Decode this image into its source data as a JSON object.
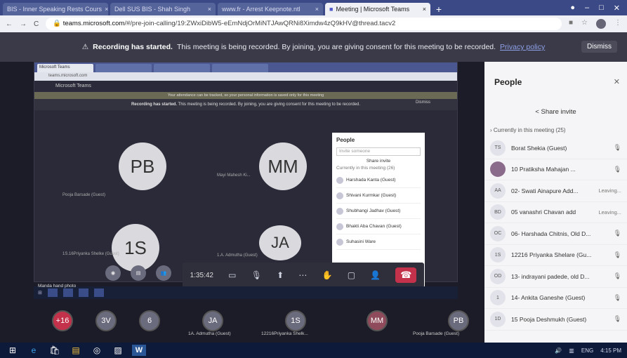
{
  "browser": {
    "tabs": [
      {
        "label": "BIS - Inner Speaking Rests Cours"
      },
      {
        "label": "Dell SUS BIS - Shah Singh"
      },
      {
        "label": "www.fr - Arrest Keepnote.ntl"
      },
      {
        "label": "Meeting | Microsoft Teams",
        "active": true
      }
    ],
    "url_host": "teams.microsoft.com",
    "url_path": "/#/pre-join-calling/19:ZWxiDibW5-eEmNdjOrMiNTJAwQRNi8Ximdw4zQ9kHV@thread.tacv2"
  },
  "banner": {
    "warning_icon": "warning-icon",
    "title": "Recording has started.",
    "text": "This meeting is being recorded. By joining, you are giving consent for this meeting to be recorded.",
    "policy_link": "Privacy policy",
    "dismiss": "Dismiss"
  },
  "shared_screen": {
    "app_title": "Microsoft Teams",
    "notice": "Your attendance can be tracked, so your personal information is saved only for this meeting",
    "rec_title": "Recording has started.",
    "rec_text": "This meeting is being recorded. By joining, you are giving consent for this meeting to be recorded.",
    "dismiss": "Dismiss",
    "tiles": [
      {
        "initials": "PB",
        "name": "Pooja Barsade (Guest)"
      },
      {
        "initials": "MM",
        "name": "Mayi Mahesh Ki..."
      },
      {
        "initials": "1S",
        "name": "1S.16Priyanka Shelke (Guest)"
      },
      {
        "initials": "JA",
        "name": "1.A. Admutha (Guest)"
      }
    ],
    "mini_people": {
      "title": "People",
      "search": "Invite someone",
      "share": "Share invite",
      "section": "Currently in this meeting (26)",
      "rows": [
        "Harshada Kanta (Guest)",
        "Shivani Kurmkar (Guest)",
        "Shubhangi Jadhav (Guest)",
        "Bhakti Aba Chavan (Guest)",
        "Suhasini Ware"
      ]
    },
    "timer": "1:35:42",
    "taskbar_label": "Manda hand photo"
  },
  "gallery": [
    {
      "initials": "+16",
      "color": "#c4314b",
      "name": ""
    },
    {
      "initials": "3V",
      "color": "#6b6b7e",
      "name": ""
    },
    {
      "initials": "6",
      "color": "#6b6b7e",
      "name": ""
    },
    {
      "initials": "JA",
      "color": "#6b6b7e",
      "name": "1A. Admutha (Guest)"
    },
    {
      "initials": "1S",
      "color": "#6b6b7e",
      "name": "12216Priyanka Shelk..."
    },
    {
      "initials": "MM",
      "color": "#8f4b5b",
      "name": ""
    },
    {
      "initials": "PB",
      "color": "#6b6b7e",
      "name": "Pooja Barsade (Guest)"
    }
  ],
  "people": {
    "title": "People",
    "close_icon": "close-icon",
    "share_invite": "Share invite",
    "section": "Currently in this meeting (25)",
    "rows": [
      {
        "initials": "TS",
        "name": "Borat Shekia (Guest)",
        "status": ""
      },
      {
        "initials": "",
        "name": "10 Pratiksha Mahajan ...",
        "status": ""
      },
      {
        "initials": "AA",
        "name": "02- Swati Ainapure Add...",
        "status": "Leaving..."
      },
      {
        "initials": "BD",
        "name": "05 vanashri Chavan add",
        "status": "Leaving..."
      },
      {
        "initials": "OC",
        "name": "06- Harshada Chitnis, Old D...",
        "status": ""
      },
      {
        "initials": "1S",
        "name": "12216 Priyanka Shelare (Gu...",
        "status": ""
      },
      {
        "initials": "OD",
        "name": "13- indrayani padede, old D...",
        "status": ""
      },
      {
        "initials": "1",
        "name": "14- Ankita Ganeshe (Guest)",
        "status": ""
      },
      {
        "initials": "1D",
        "name": "15 Pooja Deshmukh (Guest)",
        "status": ""
      }
    ]
  },
  "taskbar": {
    "time": "4:15 PM",
    "lang": "ENG"
  }
}
